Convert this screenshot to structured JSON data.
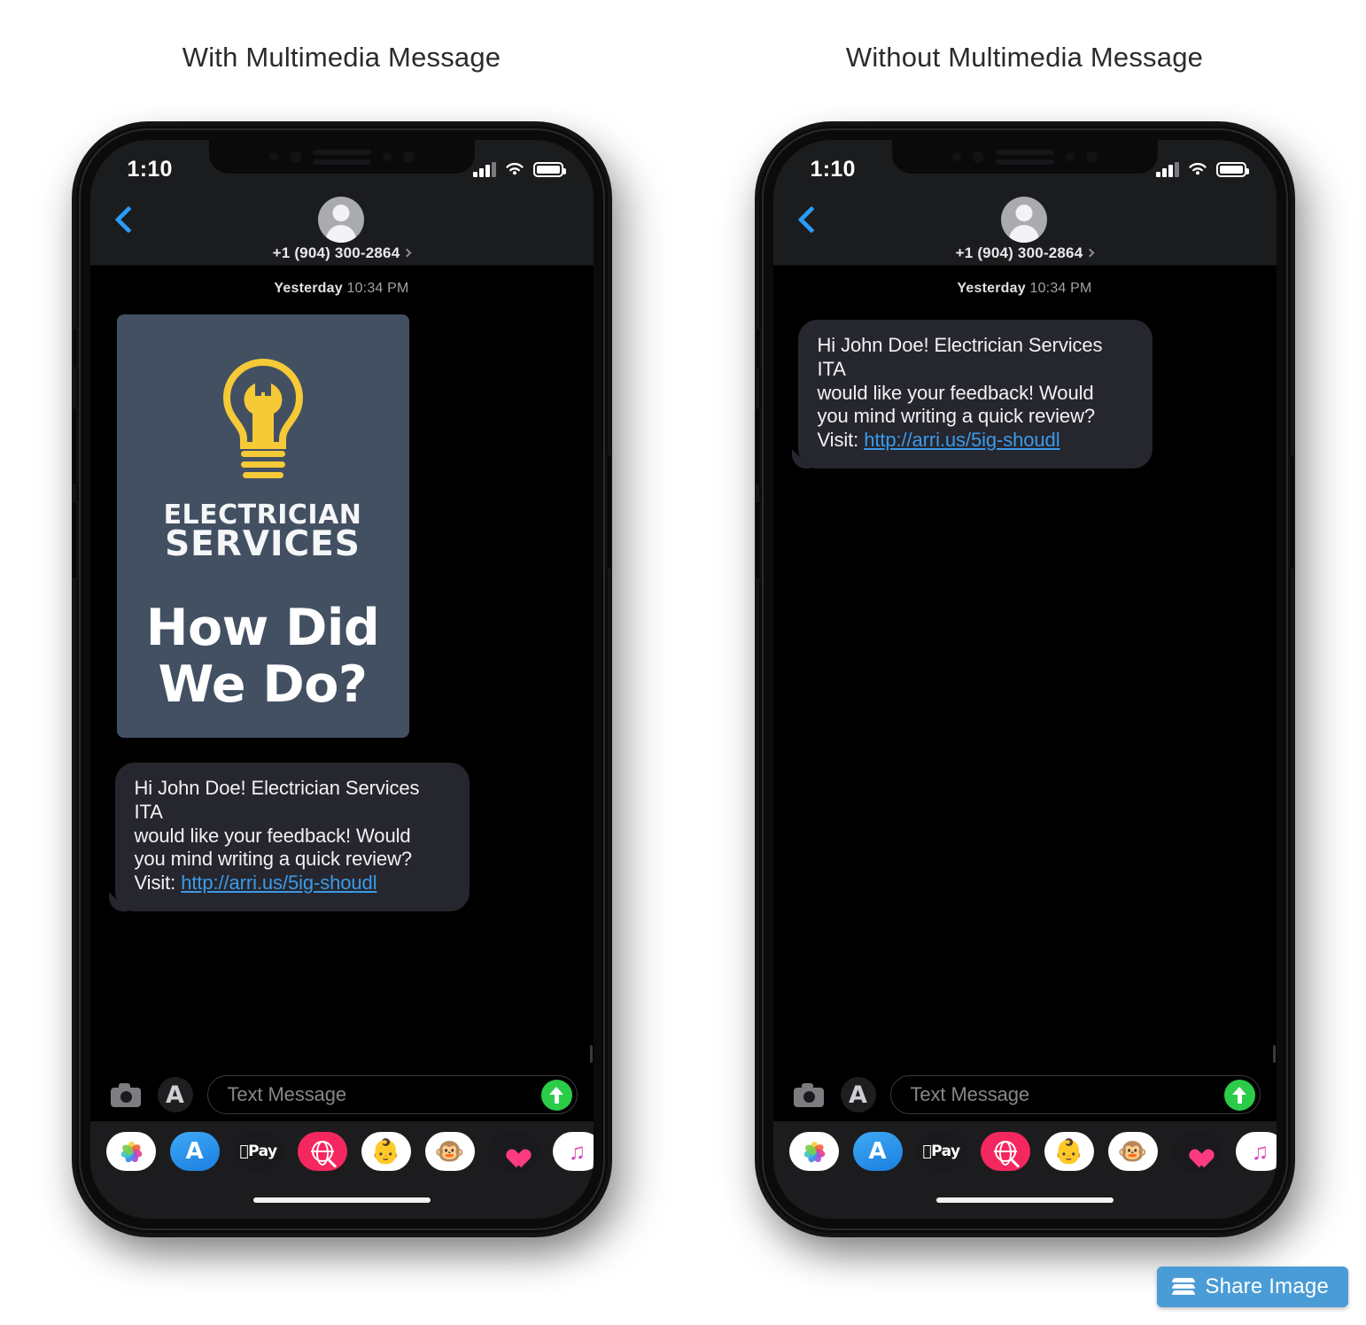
{
  "titles": {
    "left": "With Multimedia Message",
    "right": "Without Multimedia Message"
  },
  "colors": {
    "accent_blue": "#2a9bf7",
    "link_blue": "#3b9ae8",
    "send_green": "#2bcc48",
    "card_bg": "#425062",
    "bubble_bg": "#26262e",
    "logo_yellow": "#f6c937",
    "share_button_blue": "#4a9cd6"
  },
  "phone": {
    "status_bar": {
      "time": "1:10",
      "signal_icon": "cellular-bars-icon",
      "wifi_icon": "wifi-icon",
      "battery_icon": "battery-full-icon"
    },
    "nav_bar": {
      "back_icon": "back-chevron-icon",
      "avatar_icon": "contact-avatar-icon",
      "contact_name": "+1 (904) 300-2864",
      "disclosure_icon": "chevron-right-icon"
    },
    "conversation": {
      "timestamp_day": "Yesterday",
      "timestamp_time": "10:34 PM",
      "message_text_1": "Hi John Doe!  Electrician Services ITA",
      "message_text_2": "would like your feedback!  Would",
      "message_text_3": "you mind writing a quick review?",
      "message_prefix_4": "Visit: ",
      "message_link": "http://arri.us/5ig-shoudl"
    },
    "mms_card": {
      "logo_icon": "lightbulb-wrench-icon",
      "brand_line_1": "ELECTRICIAN",
      "brand_line_2": "SERVICES",
      "headline_line_1": "How Did",
      "headline_line_2": "We Do?"
    },
    "dock": {
      "camera_icon": "camera-icon",
      "appstore_icon": "app-store-icon",
      "input_placeholder": "Text Message",
      "input_value": "",
      "send_icon": "send-arrow-up-icon"
    },
    "app_drawer": [
      {
        "name": "photos-app-icon",
        "glyph": "",
        "style": "white"
      },
      {
        "name": "app-store-app-icon",
        "glyph": "A",
        "style": "blue"
      },
      {
        "name": "apple-pay-app-icon",
        "glyph": "Pay",
        "style": "black"
      },
      {
        "name": "image-search-app-icon",
        "glyph": "",
        "style": "pink"
      },
      {
        "name": "memoji-stickers-app-icon",
        "glyph": "👶",
        "style": "white"
      },
      {
        "name": "animoji-monkey-app-icon",
        "glyph": "🐵",
        "style": "white"
      },
      {
        "name": "digital-touch-app-icon",
        "glyph": "",
        "style": "black"
      },
      {
        "name": "music-app-icon",
        "glyph": "♪",
        "style": "white"
      }
    ],
    "home_indicator": "home-indicator-bar"
  },
  "share_button": {
    "label": "Share Image",
    "icon": "layers-stack-icon"
  }
}
